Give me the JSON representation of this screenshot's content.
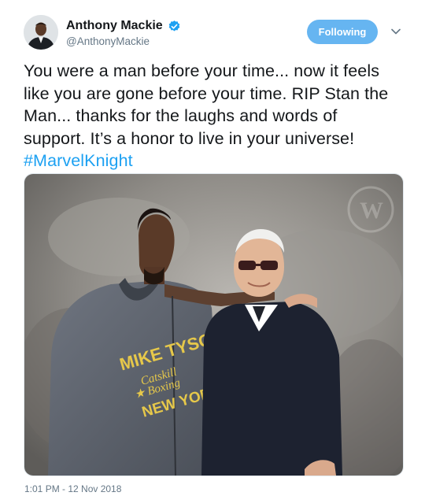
{
  "user": {
    "display_name": "Anthony Mackie",
    "handle": "@AnthonyMackie",
    "verified": true
  },
  "follow_button": {
    "label": "Following"
  },
  "menu": {
    "icon": "chevron-down-icon"
  },
  "tweet": {
    "text": "You were a man before your time... now it feels like you are gone before your time. RIP Stan the Man... thanks for the laughs and words of support. It’s a honor to live in your universe! ",
    "hashtag": "#MarvelKnight",
    "timestamp": "1:01 PM - 12 Nov 2018"
  },
  "photo": {
    "shirt_text": [
      "MIKE TYSON",
      "Catskill",
      "Boxing",
      "NEW YORK"
    ]
  },
  "colors": {
    "accent": "#1da1f2",
    "following_bg": "#66b5f1",
    "secondary_text": "#657786"
  }
}
